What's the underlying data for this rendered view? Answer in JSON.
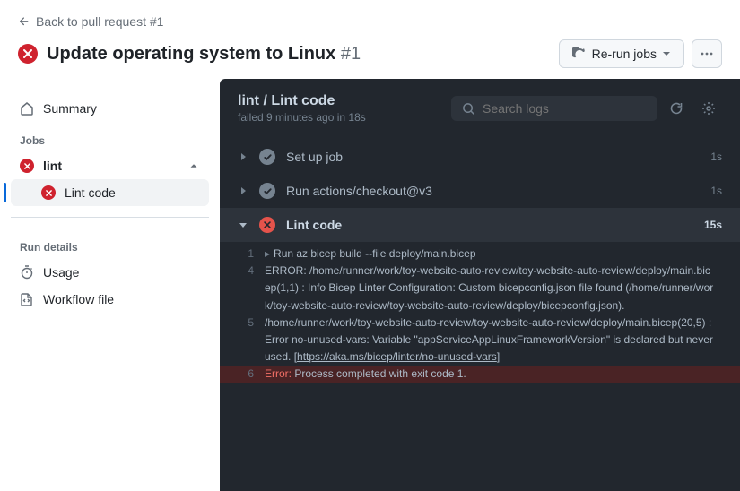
{
  "back_link": "Back to pull request #1",
  "page_title": "Update operating system to Linux",
  "page_number": "#1",
  "rerun_label": "Re-run jobs",
  "sidebar": {
    "summary": "Summary",
    "jobs_label": "Jobs",
    "job": "lint",
    "job_step": "Lint code",
    "details_label": "Run details",
    "usage": "Usage",
    "workflow_file": "Workflow file"
  },
  "detail": {
    "title": "lint / Lint code",
    "subtitle": "failed 9 minutes ago in 18s",
    "search_placeholder": "Search logs",
    "steps": [
      {
        "name": "Set up job",
        "dur": "1s"
      },
      {
        "name": "Run actions/checkout@v3",
        "dur": "1s"
      },
      {
        "name": "Lint code",
        "dur": "15s"
      }
    ],
    "log": [
      {
        "n": "1",
        "text": "Run az bicep build --file deploy/main.bicep",
        "collapsible": true
      },
      {
        "n": "4",
        "text": "ERROR: /home/runner/work/toy-website-auto-review/toy-website-auto-review/deploy/main.bicep(1,1) : Info Bicep Linter Configuration: Custom bicepconfig.json file found (/home/runner/work/toy-website-auto-review/toy-website-auto-review/deploy/bicepconfig.json)."
      },
      {
        "n": "5",
        "text": "/home/runner/work/toy-website-auto-review/toy-website-auto-review/deploy/main.bicep(20,5) : Error no-unused-vars: Variable \"appServiceAppLinuxFrameworkVersion\" is declared but never used. [https://aka.ms/bicep/linter/no-unused-vars]",
        "link": "https://aka.ms/bicep/linter/no-unused-vars"
      },
      {
        "n": "6",
        "err": true,
        "label": "Error:",
        "text": "Process completed with exit code 1."
      }
    ]
  }
}
